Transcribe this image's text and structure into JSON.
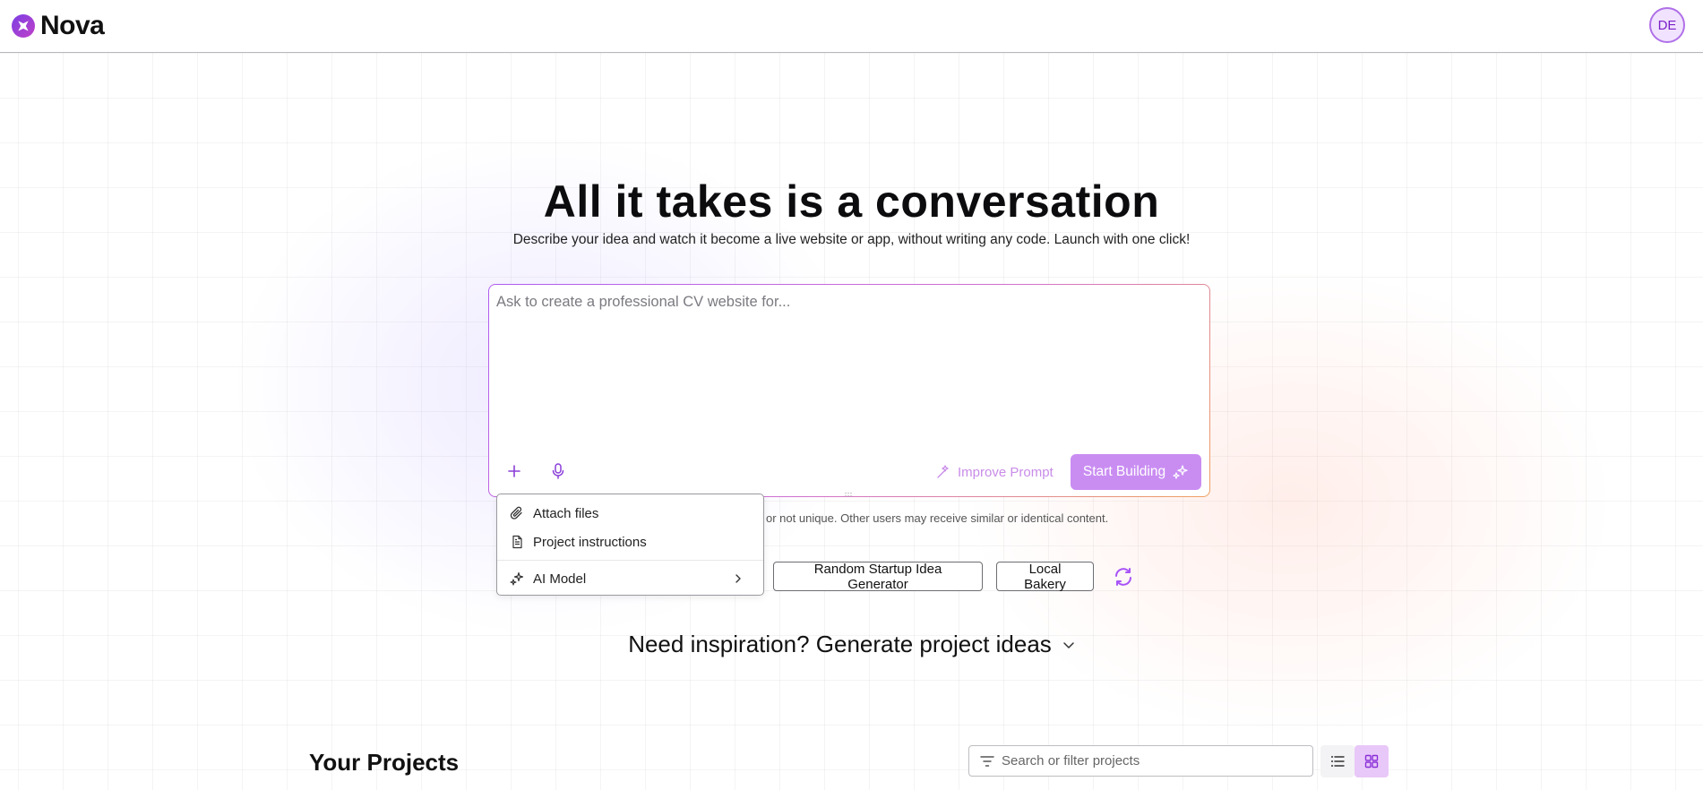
{
  "app": {
    "name": "Nova",
    "user_initials": "DE"
  },
  "hero": {
    "title": "All it takes is a conversation",
    "subtitle": "Describe your idea and watch it become a live website or app, without writing any code. Launch with one click!"
  },
  "prompt": {
    "placeholder": "Ask to create a professional CV website for...",
    "value": "",
    "improve_label": "Improve Prompt",
    "start_label": "Start Building"
  },
  "disclaimer": "or not unique. Other users may receive similar or identical content.",
  "menu": {
    "items": [
      {
        "label": "Attach files",
        "icon": "paperclip-icon"
      },
      {
        "label": "Project instructions",
        "icon": "document-icon"
      },
      {
        "label": "AI Model",
        "icon": "sparkles-icon",
        "has_submenu": true
      }
    ]
  },
  "suggestions": [
    "Random Startup Idea Generator",
    "Local Bakery"
  ],
  "inspiration": {
    "label": "Need inspiration? Generate project ideas"
  },
  "projects": {
    "title": "Your Projects",
    "search_placeholder": "Search or filter projects",
    "view_mode": "grid"
  },
  "colors": {
    "accent": "#a855f7",
    "button": "#c98df2",
    "gradient_end": "#f0a060"
  }
}
